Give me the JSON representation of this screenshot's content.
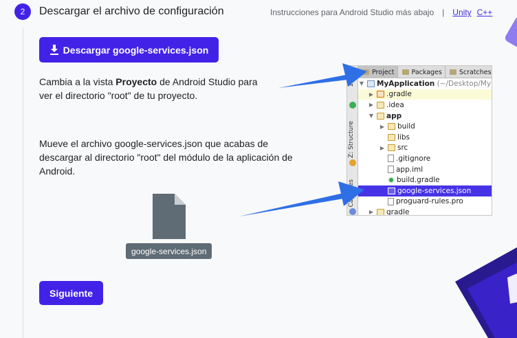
{
  "step": {
    "number": "2",
    "title": "Descargar el archivo de configuración"
  },
  "platform_links": {
    "text": "Instrucciones para Android Studio más abajo",
    "separator": "|",
    "unity": "Unity",
    "cpp": "C++"
  },
  "download_button": {
    "label": "Descargar google-services.json",
    "icon": "download-icon"
  },
  "instructions": {
    "p1_before": "Cambia a la vista ",
    "p1_bold": "Proyecto",
    "p1_after": " de Android Studio para ver el directorio \"root\" de tu proyecto.",
    "p2": "Mueve el archivo google-services.json que acabas de descargar al directorio \"root\" del módulo de la aplicación de Android."
  },
  "file_preview": {
    "label": "google-services.json",
    "icon": "file-icon"
  },
  "next_button": {
    "label": "Siguiente"
  },
  "ide": {
    "tabs": [
      "Project",
      "Packages",
      "Scratches"
    ],
    "side_labels": [
      "1:",
      "Z: Structure",
      "Captures"
    ],
    "tree": {
      "root_name": "MyApplication",
      "root_path": "(~/Desktop/My",
      "gradle_hidden": ".gradle",
      "idea": ".idea",
      "app": "app",
      "build": "build",
      "libs": "libs",
      "src": "src",
      "gitignore": ".gitignore",
      "app_iml": "app.iml",
      "build_gradle": "build.gradle",
      "google_services": "google-services.json",
      "proguard": "proguard-rules.pro",
      "gradle": "gradle"
    }
  },
  "colors": {
    "accent": "#4322e8",
    "link": "#3a2ee0",
    "arrow": "#2f6fe6"
  }
}
